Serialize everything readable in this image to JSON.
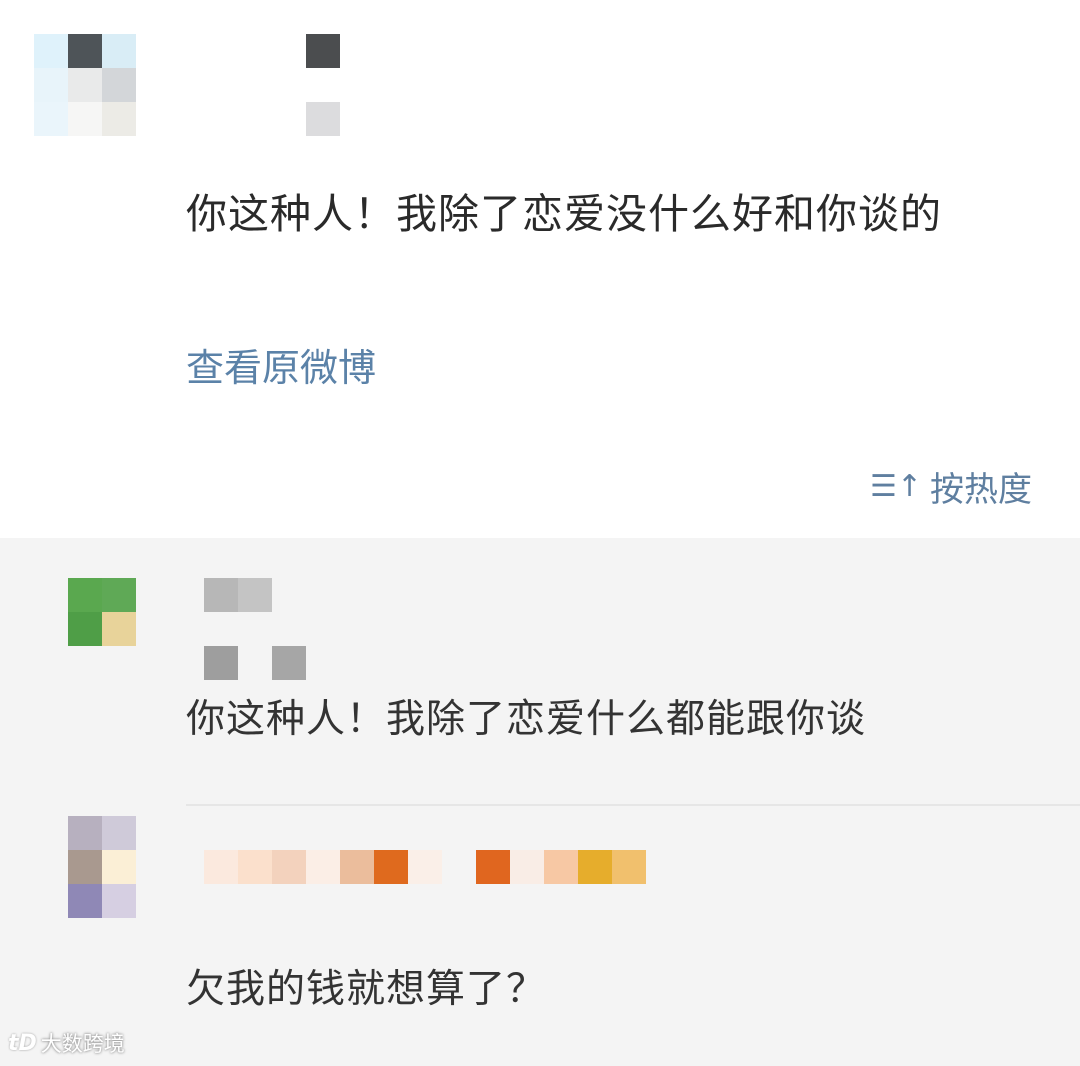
{
  "post": {
    "text": "你这种人！我除了恋爱没什么好和你谈的",
    "view_original": "查看原微博"
  },
  "sort": {
    "icon": "sort-hot-icon",
    "icon_glyph": "☰↑",
    "label": "按热度"
  },
  "comments": [
    {
      "text": "你这种人！我除了恋爱什么都能跟你谈"
    },
    {
      "text": "欠我的钱就想算了？"
    }
  ],
  "watermark": {
    "logo": "bigdata-logo",
    "text": "大数跨境"
  },
  "colors": {
    "link": "#5b82a8",
    "comments_bg": "#f4f4f4",
    "text": "#2a2a2a"
  }
}
